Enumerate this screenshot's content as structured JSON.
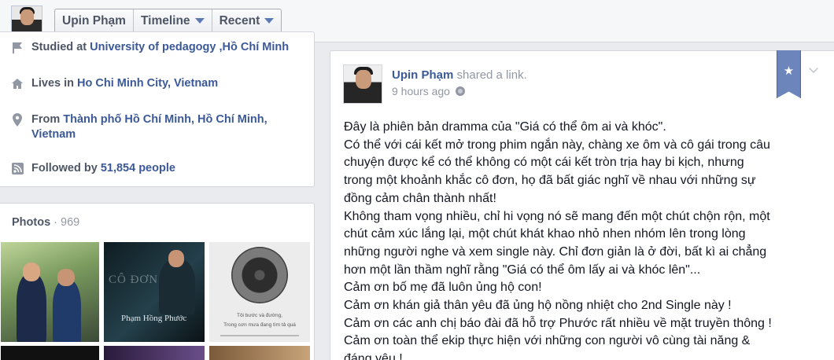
{
  "topbar": {
    "nav": [
      {
        "label": "Upin Phạm",
        "dropdown": false
      },
      {
        "label": "Timeline",
        "dropdown": true
      },
      {
        "label": "Recent",
        "dropdown": true
      }
    ]
  },
  "about": {
    "studied": {
      "prefix": "Studied at ",
      "link": "University of pedagogy ,Hồ Chí Minh"
    },
    "lives": {
      "prefix": "Lives in ",
      "link": "Ho Chi Minh City, Vietnam"
    },
    "from": {
      "prefix": "From ",
      "link": "Thành phố Hồ Chí Minh, Hồ Chí Minh, Vietnam"
    },
    "followed": {
      "prefix": "Followed by ",
      "link": "51,854 people"
    }
  },
  "photos": {
    "title": "Photos",
    "separator": " · ",
    "count": "969",
    "photo2_caption": "Phạm Hồng Phước",
    "photo3_lines": [
      "Tôi bước và đường,",
      "Trong cơn mưa đang tìm tả quá"
    ]
  },
  "post": {
    "author": "Upin Phạm",
    "action": "shared a link.",
    "time": "9 hours ago",
    "lines": [
      "Đây là phiên bản dramma của \"Giá có thể ôm ai và khóc\".",
      "Có thể với cái kết mở trong phim ngắn này, chàng xe ôm và cô gái trong câu",
      "chuyện được kể có thể không có một cái kết tròn trịa hay bi kịch, nhưng",
      "trong một khoảnh khắc cô đơn, họ đã bất giác nghĩ về nhau với những sự",
      "đồng cảm chân thành nhất!",
      "Không tham vọng nhiều, chỉ hi vọng nó sẽ mang đến một chút chộn rộn, một",
      "chút cảm xúc lắng lại, một chút khát khao nhỏ nhen nhóm lên trong lòng",
      "những người nghe và xem single này. Chỉ đơn giản là ở đời, bất kì ai chẳng",
      "hơn một lần thầm nghĩ rằng \"Giá có thể ôm lấy ai và khóc lên\"...",
      "Cảm ơn bố mẹ đã luôn ủng hộ con!",
      "Cảm ơn khán giả thân yêu đã ủng hộ nồng nhiệt cho 2nd Single này !",
      "Cảm ơn các anh chị báo đài đã hỗ trợ Phước rất nhiều về mặt truyền thông !",
      "Cảm ơn toàn thể ekip thực hiện với những con người vô cùng tài năng &",
      "đáng yêu !"
    ]
  },
  "icons": {
    "ribbon": "star-icon",
    "caret": "caret-down-icon"
  },
  "colors": {
    "link": "#3b5998",
    "muted": "#9197a3",
    "ribbon": "#6c86bc"
  }
}
